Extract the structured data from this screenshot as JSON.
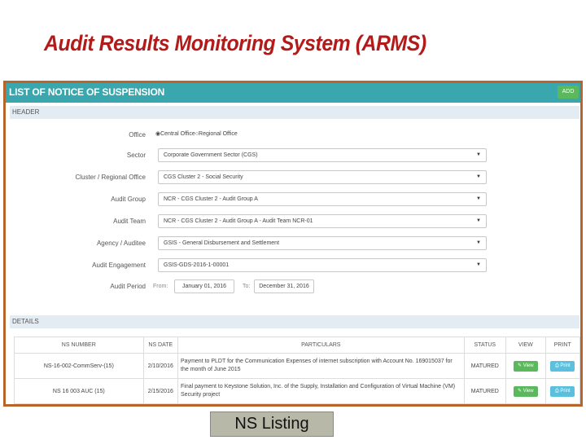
{
  "slide": {
    "title": "Audit Results Monitoring System (ARMS)",
    "caption": "NS Listing"
  },
  "screen": {
    "title": "LIST OF NOTICE OF SUSPENSION",
    "add_label": "ADD",
    "header_section": "HEADER",
    "details_section": "DETAILS",
    "accent": "#3aa6ad",
    "border_color": "#b8652d"
  },
  "form": {
    "office": {
      "label": "Office",
      "options": [
        "Central Office",
        "Regional Office"
      ],
      "selected": "Central Office"
    },
    "sector": {
      "label": "Sector",
      "value": "Corporate Government Sector (CGS)"
    },
    "cluster": {
      "label": "Cluster / Regional Office",
      "value": "CGS Cluster 2 - Social Security"
    },
    "audit_group": {
      "label": "Audit Group",
      "value": "NCR - CGS Cluster 2 - Audit Group A"
    },
    "audit_team": {
      "label": "Audit Team",
      "value": "NCR - CGS Cluster 2 - Audit Group A - Audit Team NCR-01"
    },
    "agency": {
      "label": "Agency / Auditee",
      "value": "GSIS - General Disbursement and Settlement"
    },
    "engagement": {
      "label": "Audit Engagement",
      "value": "GSIS-GDS-2016-1-00001"
    },
    "period": {
      "label": "Audit Period",
      "from_label": "From:",
      "from_value": "January 01, 2016",
      "to_label": "To:",
      "to_value": "December 31, 2016"
    }
  },
  "table": {
    "headers": [
      "NS NUMBER",
      "NS DATE",
      "PARTICULARS",
      "STATUS",
      "VIEW",
      "PRINT"
    ],
    "rows": [
      {
        "ns_number": "NS-16-002-CommServ-(15)",
        "ns_date": "2/10/2016",
        "particulars": "Payment to PLDT for the Communication Expenses of internet subscription with Account No. 169015037 for the month of June 2015",
        "status": "MATURED",
        "view": "View",
        "print": "Print"
      },
      {
        "ns_number": "NS 16 003 AUC (15)",
        "ns_date": "2/15/2016",
        "particulars": "Final payment to Keystone Solution, Inc. of the Supply, Installation and Configuration of Virtual Machine (VM) Security project",
        "status": "MATURED",
        "view": "View",
        "print": "Print"
      }
    ]
  }
}
